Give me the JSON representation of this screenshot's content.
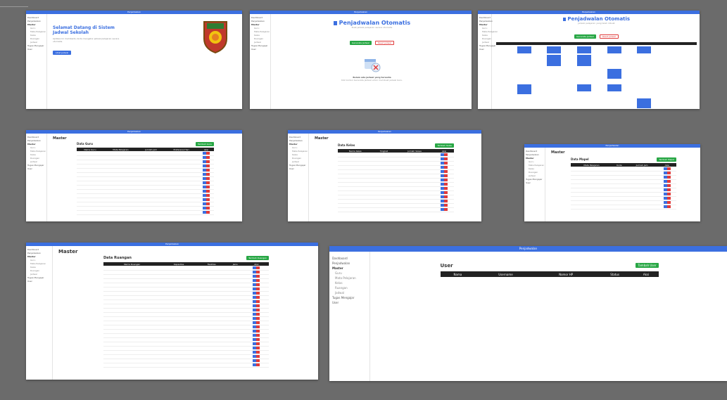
{
  "app_title": "Penjadwalan",
  "sidebar": {
    "dashboard": "Dashboard",
    "penjadwalan": "Penjadwalan",
    "master": "Master",
    "master_items": [
      "Guru",
      "Mata Pelajaran",
      "Kelas",
      "Ruangan",
      "Jadwal"
    ],
    "tugas": "Tugas Mengajar",
    "user": "User"
  },
  "screen1": {
    "heading": "Selamat Datang di Sistem Jadwal Sekolah",
    "body": "Aplikasi ini membantu Anda mengatur jadwal pelajaran secara otomatis.",
    "button": "Lihat Jadwal"
  },
  "screen2": {
    "title": "Penjadwalan Otomatis",
    "subtitle": "Buat jadwal pelajaran secara otomatis",
    "generate_btn": "Generate Jadwal",
    "reset_btn": "Reset Jadwal",
    "empty_title": "Belum ada jadwal yang tersedia",
    "empty_text": "Klik tombol Generate Jadwal untuk membuat jadwal baru."
  },
  "screen3": {
    "title": "Penjadwalan Otomatis",
    "subtitle": "Jadwal pelajaran yang telah dibuat",
    "generate_btn": "Generate Jadwal",
    "reset_btn": "Reset Jadwal"
  },
  "screen4": {
    "page_title": "Master",
    "card_title": "Data Guru",
    "columns": [
      "Nama Guru",
      "Mata Pelajaran",
      "Jumlah Jam",
      "Preferensi Hari",
      "Aksi"
    ],
    "add_btn": "Tambah Guru"
  },
  "screen5": {
    "page_title": "Master",
    "card_title": "Data Kelas",
    "columns": [
      "Nama Kelas",
      "Tingkat",
      "Jumlah Siswa",
      "Aksi"
    ],
    "add_btn": "Tambah Kelas"
  },
  "screen6": {
    "page_title": "Master",
    "card_title": "Data Mapel",
    "columns": [
      "Mata Pelajaran",
      "Kode",
      "Jumlah Jam",
      "Aksi"
    ],
    "add_btn": "Tambah Mapel"
  },
  "screen7": {
    "page_title": "Master",
    "card_title": "Data Ruangan",
    "columns": [
      "Nama Ruangan",
      "Kapasitas",
      "Fasilitas",
      "Jenis",
      "Aksi"
    ],
    "add_btn": "Tambah Ruangan"
  },
  "screen8": {
    "page_title": "User",
    "columns": [
      "Nama",
      "Username",
      "Nomor HP",
      "Status",
      "Aksi"
    ],
    "add_btn": "Tambah User"
  },
  "colors": {
    "primary": "#3b6fe0",
    "success": "#28a745",
    "danger": "#e03b3b",
    "header_dark": "#222222"
  }
}
